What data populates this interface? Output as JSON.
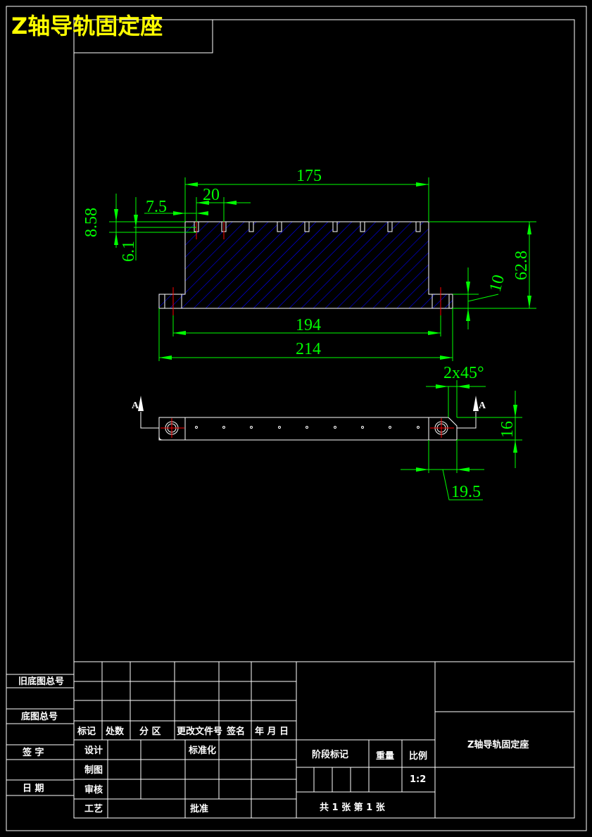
{
  "drawing_title": "Z轴导轨固定座",
  "dimensions": {
    "d175": "175",
    "d20": "20",
    "d7_5": "7.5",
    "d8_58": "8.58",
    "d6_1": "6.1",
    "d62_8": "62.8",
    "d10": "10",
    "d194": "194",
    "d214": "214",
    "chamfer": "2x45°",
    "d16": "16",
    "d19_5": "19.5"
  },
  "section_marks": {
    "left": "A",
    "right": "A"
  },
  "title_block": {
    "left_column": [
      "旧底图总号",
      "底图总号",
      "签 字",
      "日 期"
    ],
    "revision_headers": [
      "标记",
      "处数",
      "分 区",
      "更改文件号",
      "签名",
      "年 月 日"
    ],
    "design": "设计",
    "drafting": "制图",
    "review": "审核",
    "process": "工艺",
    "standardization": "标准化",
    "approval": "批准",
    "stage_mark": "阶段标记",
    "weight": "重量",
    "scale_label": "比例",
    "scale_value": "1:2",
    "sheet": "共 1 张 第 1 张",
    "drawing_name": "Z轴导轨固定座"
  },
  "colors": {
    "background": "#000000",
    "lines": "#ffffff",
    "dimensions": "#00ff00",
    "centerlines": "#ff0000",
    "hatch": "#0000ff",
    "title": "#ffff00"
  }
}
